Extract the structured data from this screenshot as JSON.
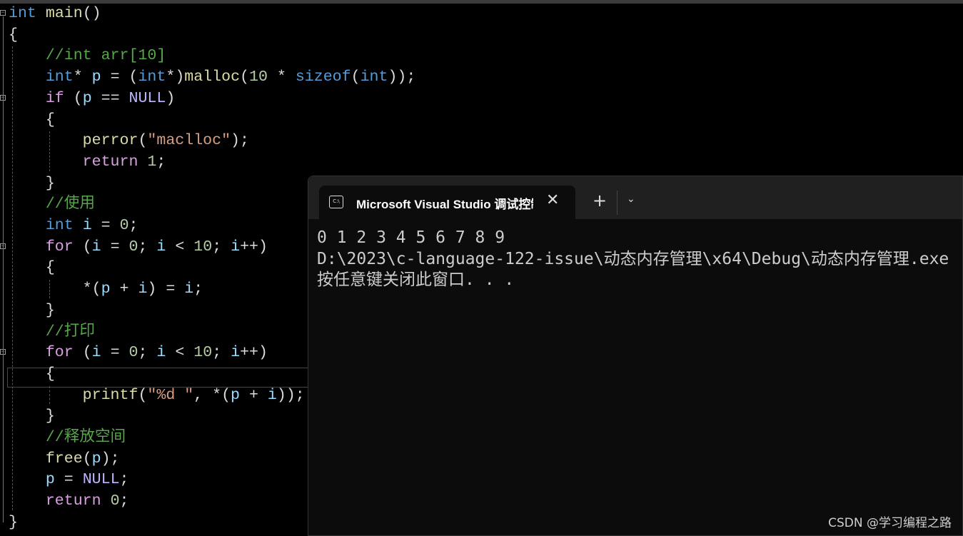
{
  "editor": {
    "lines": [
      [
        [
          "int",
          "kw"
        ],
        [
          " ",
          "pl"
        ],
        [
          "main",
          "fn"
        ],
        [
          "()",
          "pl"
        ]
      ],
      [
        [
          "{",
          "pl"
        ]
      ],
      [
        [
          "    ",
          "pl"
        ],
        [
          "//int arr[10]",
          "cm"
        ]
      ],
      [
        [
          "    ",
          "pl"
        ],
        [
          "int",
          "kw"
        ],
        [
          "* ",
          "pl"
        ],
        [
          "p",
          "var"
        ],
        [
          " = (",
          "pl"
        ],
        [
          "int",
          "kw"
        ],
        [
          "*)",
          "pl"
        ],
        [
          "malloc",
          "fn"
        ],
        [
          "(",
          "pl"
        ],
        [
          "10",
          "num"
        ],
        [
          " * ",
          "pl"
        ],
        [
          "sizeof",
          "kw"
        ],
        [
          "(",
          "pl"
        ],
        [
          "int",
          "kw"
        ],
        [
          "));",
          "pl"
        ]
      ],
      [
        [
          "    ",
          "pl"
        ],
        [
          "if",
          "ctl"
        ],
        [
          " (",
          "pl"
        ],
        [
          "p",
          "var"
        ],
        [
          " == ",
          "pl"
        ],
        [
          "NULL",
          "mac"
        ],
        [
          ")",
          "pl"
        ]
      ],
      [
        [
          "    {",
          "pl"
        ]
      ],
      [
        [
          "        ",
          "pl"
        ],
        [
          "perror",
          "fn"
        ],
        [
          "(",
          "pl"
        ],
        [
          "\"maclloc\"",
          "str"
        ],
        [
          ");",
          "pl"
        ]
      ],
      [
        [
          "        ",
          "pl"
        ],
        [
          "return",
          "ctl"
        ],
        [
          " ",
          "pl"
        ],
        [
          "1",
          "num"
        ],
        [
          ";",
          "pl"
        ]
      ],
      [
        [
          "    }",
          "pl"
        ]
      ],
      [
        [
          "    ",
          "pl"
        ],
        [
          "//使用",
          "cm"
        ]
      ],
      [
        [
          "    ",
          "pl"
        ],
        [
          "int",
          "kw"
        ],
        [
          " ",
          "pl"
        ],
        [
          "i",
          "var"
        ],
        [
          " = ",
          "pl"
        ],
        [
          "0",
          "num"
        ],
        [
          ";",
          "pl"
        ]
      ],
      [
        [
          "    ",
          "pl"
        ],
        [
          "for",
          "ctl"
        ],
        [
          " (",
          "pl"
        ],
        [
          "i",
          "var"
        ],
        [
          " = ",
          "pl"
        ],
        [
          "0",
          "num"
        ],
        [
          "; ",
          "pl"
        ],
        [
          "i",
          "var"
        ],
        [
          " < ",
          "pl"
        ],
        [
          "10",
          "num"
        ],
        [
          "; ",
          "pl"
        ],
        [
          "i",
          "var"
        ],
        [
          "++)",
          "pl"
        ]
      ],
      [
        [
          "    {",
          "pl"
        ]
      ],
      [
        [
          "        *(",
          "pl"
        ],
        [
          "p",
          "var"
        ],
        [
          " + ",
          "pl"
        ],
        [
          "i",
          "var"
        ],
        [
          ") = ",
          "pl"
        ],
        [
          "i",
          "var"
        ],
        [
          ";",
          "pl"
        ]
      ],
      [
        [
          "    }",
          "pl"
        ]
      ],
      [
        [
          "    ",
          "pl"
        ],
        [
          "//打印",
          "cm"
        ]
      ],
      [
        [
          "    ",
          "pl"
        ],
        [
          "for",
          "ctl"
        ],
        [
          " (",
          "pl"
        ],
        [
          "i",
          "var"
        ],
        [
          " = ",
          "pl"
        ],
        [
          "0",
          "num"
        ],
        [
          "; ",
          "pl"
        ],
        [
          "i",
          "var"
        ],
        [
          " < ",
          "pl"
        ],
        [
          "10",
          "num"
        ],
        [
          "; ",
          "pl"
        ],
        [
          "i",
          "var"
        ],
        [
          "++)",
          "pl"
        ]
      ],
      [
        [
          "    {",
          "pl"
        ]
      ],
      [
        [
          "        ",
          "pl"
        ],
        [
          "printf",
          "fn"
        ],
        [
          "(",
          "pl"
        ],
        [
          "\"%d \"",
          "str"
        ],
        [
          ", *(",
          "pl"
        ],
        [
          "p",
          "var"
        ],
        [
          " + ",
          "pl"
        ],
        [
          "i",
          "var"
        ],
        [
          "));",
          "pl"
        ]
      ],
      [
        [
          "    }",
          "pl"
        ]
      ],
      [
        [
          "    ",
          "pl"
        ],
        [
          "//释放空间",
          "cm"
        ]
      ],
      [
        [
          "    ",
          "pl"
        ],
        [
          "free",
          "fn"
        ],
        [
          "(",
          "pl"
        ],
        [
          "p",
          "var"
        ],
        [
          ");",
          "pl"
        ]
      ],
      [
        [
          "    ",
          "pl"
        ],
        [
          "p",
          "var"
        ],
        [
          " = ",
          "pl"
        ],
        [
          "NULL",
          "mac"
        ],
        [
          ";",
          "pl"
        ]
      ],
      [
        [
          "    ",
          "pl"
        ],
        [
          "return",
          "ctl"
        ],
        [
          " ",
          "pl"
        ],
        [
          "0",
          "num"
        ],
        [
          ";",
          "pl"
        ]
      ],
      [
        [
          "}",
          "pl"
        ]
      ]
    ]
  },
  "terminal": {
    "tab_title": "Microsoft Visual Studio 调试控制台",
    "tab_icon": "C:\\",
    "close_icon": "✕",
    "new_tab_icon": "+",
    "dropdown_icon": "⌄",
    "output": [
      "0 1 2 3 4 5 6 7 8 9",
      "D:\\2023\\c-language-122-issue\\动态内存管理\\x64\\Debug\\动态内存管理.exe",
      "按任意键关闭此窗口. . ."
    ]
  },
  "watermark": "CSDN @学习编程之路"
}
